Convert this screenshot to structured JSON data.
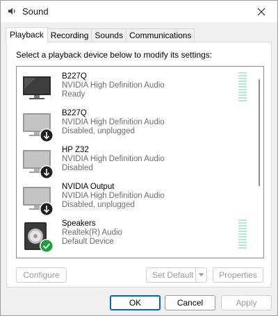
{
  "window": {
    "title": "Sound"
  },
  "tabs": [
    {
      "label": "Playback"
    },
    {
      "label": "Recording"
    },
    {
      "label": "Sounds"
    },
    {
      "label": "Communications"
    }
  ],
  "instruction": "Select a playback device below to modify its settings:",
  "devices": [
    {
      "name": "B227Q",
      "driver": "NVIDIA High Definition Audio",
      "status": "Ready",
      "icon": "monitor-icon",
      "state": "ready"
    },
    {
      "name": "B227Q",
      "driver": "NVIDIA High Definition Audio",
      "status": "Disabled, unplugged",
      "icon": "monitor-disabled-icon",
      "state": "disabled"
    },
    {
      "name": "HP Z32",
      "driver": "NVIDIA High Definition Audio",
      "status": "Disabled",
      "icon": "monitor-disabled-icon",
      "state": "disabled"
    },
    {
      "name": "NVIDIA Output",
      "driver": "NVIDIA High Definition Audio",
      "status": "Disabled, unplugged",
      "icon": "monitor-disabled-icon",
      "state": "disabled"
    },
    {
      "name": "Speakers",
      "driver": "Realtek(R) Audio",
      "status": "Default Device",
      "icon": "speaker-default-icon",
      "state": "default"
    }
  ],
  "buttons": {
    "configure": "Configure",
    "set_default": "Set Default",
    "properties": "Properties",
    "ok": "OK",
    "cancel": "Cancel",
    "apply": "Apply"
  },
  "colors": {
    "accent": "#0067c0",
    "default_check": "#1e9e3e",
    "level_meter": "#b6e6d6"
  }
}
